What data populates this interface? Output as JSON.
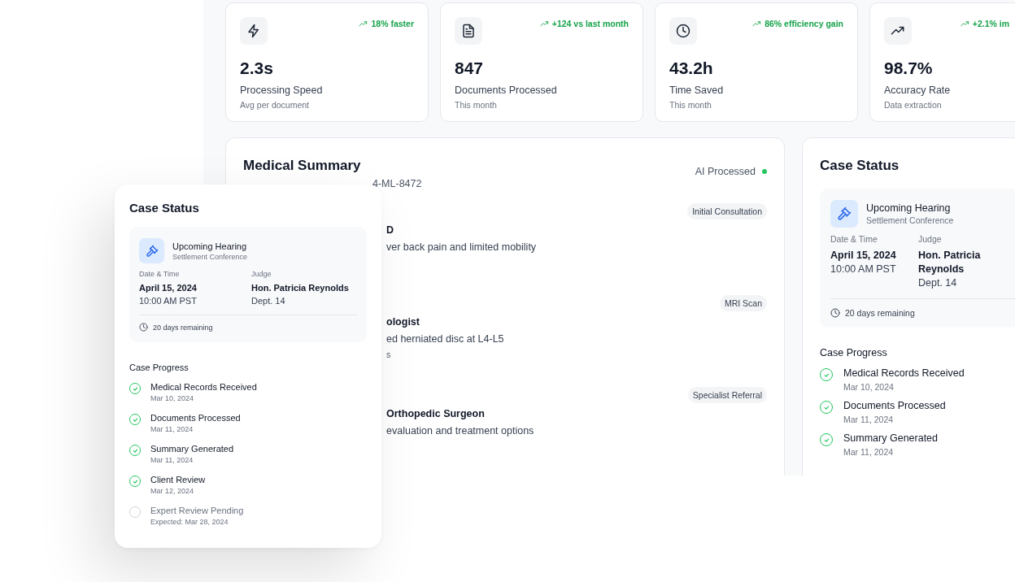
{
  "stats": [
    {
      "kind": "bolt",
      "trend": "18% faster",
      "value": "2.3s",
      "label": "Processing Speed",
      "sub": "Avg per document"
    },
    {
      "kind": "document",
      "trend": "+124 vs last month",
      "value": "847",
      "label": "Documents Processed",
      "sub": "This month"
    },
    {
      "kind": "clock",
      "trend": "86% efficiency gain",
      "value": "43.2h",
      "label": "Time Saved",
      "sub": "This month"
    },
    {
      "kind": "trend",
      "trend": "+2.1% im",
      "value": "98.7%",
      "label": "Accuracy Rate",
      "sub": "Data extraction"
    }
  ],
  "medical_summary": {
    "title": "Medical Summary",
    "case_id": "4-ML-8472",
    "status": "AI Processed",
    "entries": [
      {
        "tag": "Initial Consultation",
        "title": "D",
        "description": "ver back pain and limited mobility"
      },
      {
        "tag": "MRI Scan",
        "title": "ologist",
        "description": "ed herniated disc at L4-L5",
        "note": "s"
      },
      {
        "tag": "Specialist Referral",
        "title": "Orthopedic Surgeon",
        "description": "evaluation and treatment options"
      }
    ]
  },
  "case_status_panel": {
    "title": "Case Status",
    "hearing": {
      "title": "Upcoming Hearing",
      "subtitle": "Settlement Conference",
      "date_label": "Date & Time",
      "date": "April 15, 2024",
      "time": "10:00 AM PST",
      "judge_label": "Judge",
      "judge": "Hon. Patricia Reynolds",
      "dept": "Dept. 14",
      "remaining": "20 days remaining"
    },
    "progress_title": "Case Progress",
    "progress": [
      {
        "label": "Medical Records Received",
        "date": "Mar 10, 2024",
        "done": true
      },
      {
        "label": "Documents Processed",
        "date": "Mar 11, 2024",
        "done": true
      },
      {
        "label": "Summary Generated",
        "date": "Mar 11, 2024",
        "done": true
      }
    ]
  },
  "floating_case_status": {
    "title": "Case Status",
    "hearing": {
      "title": "Upcoming Hearing",
      "subtitle": "Settlement Conference",
      "date_label": "Date & Time",
      "date": "April 15, 2024",
      "time": "10:00 AM PST",
      "judge_label": "Judge",
      "judge": "Hon. Patricia Reynolds",
      "dept": "Dept. 14",
      "remaining": "20 days remaining"
    },
    "progress_title": "Case Progress",
    "progress": [
      {
        "label": "Medical Records Received",
        "date": "Mar 10, 2024",
        "done": true
      },
      {
        "label": "Documents Processed",
        "date": "Mar 11, 2024",
        "done": true
      },
      {
        "label": "Summary Generated",
        "date": "Mar 11, 2024",
        "done": true
      },
      {
        "label": "Client Review",
        "date": "Mar 12, 2024",
        "done": true
      },
      {
        "label": "Expert Review Pending",
        "date": "Expected: Mar 28, 2024",
        "done": false
      }
    ]
  }
}
